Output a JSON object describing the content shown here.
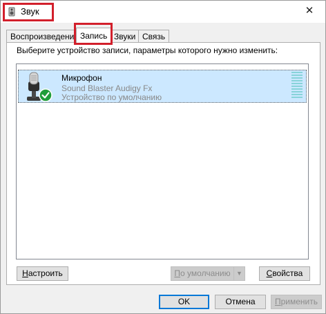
{
  "window": {
    "title": "Звук",
    "close_glyph": "✕"
  },
  "tabs": [
    {
      "label": "Воспроизведение"
    },
    {
      "label": "Запись"
    },
    {
      "label": "Звуки"
    },
    {
      "label": "Связь"
    }
  ],
  "active_tab": "Запись",
  "instruction": "Выберите устройство записи, параметры которого нужно изменить:",
  "devices": [
    {
      "name": "Микрофон",
      "description": "Sound Blaster Audigy Fx",
      "status": "Устройство по умолчанию",
      "icon": "microphone-icon",
      "badge": "default-checkmark-icon",
      "level": 0
    }
  ],
  "buttons": {
    "setup_hotkey": "Н",
    "setup_rest": "астроить",
    "default_hotkey": "П",
    "default_rest": "о умолчанию",
    "properties_hotkey": "С",
    "properties_rest": "войства",
    "ok": "OK",
    "cancel": "Отмена",
    "apply_hotkey": "П",
    "apply_rest": "рименить"
  },
  "colors": {
    "highlight_border": "#d21f2b",
    "selected_row": "#cce8ff",
    "default_badge": "#1f9d3a",
    "focus_border": "#0078d7"
  }
}
